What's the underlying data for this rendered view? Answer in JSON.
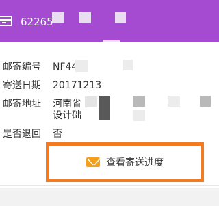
{
  "header": {
    "card_number": "62265",
    "card_icon": "bank-card-icon"
  },
  "details": {
    "rows": [
      {
        "label": "邮寄编号",
        "value": "NF44"
      },
      {
        "label": "寄送日期",
        "value": "20171213"
      },
      {
        "label": "邮寄地址",
        "value": "河南省",
        "value2": "设计础"
      },
      {
        "label": "是否退回",
        "value": "否"
      }
    ]
  },
  "action": {
    "label": "查看寄送进度",
    "icon": "envelope-icon",
    "icon_color": "#f4a01c",
    "highlight_color": "#f47b20"
  },
  "colors": {
    "header_bg": "#a44bd1"
  }
}
